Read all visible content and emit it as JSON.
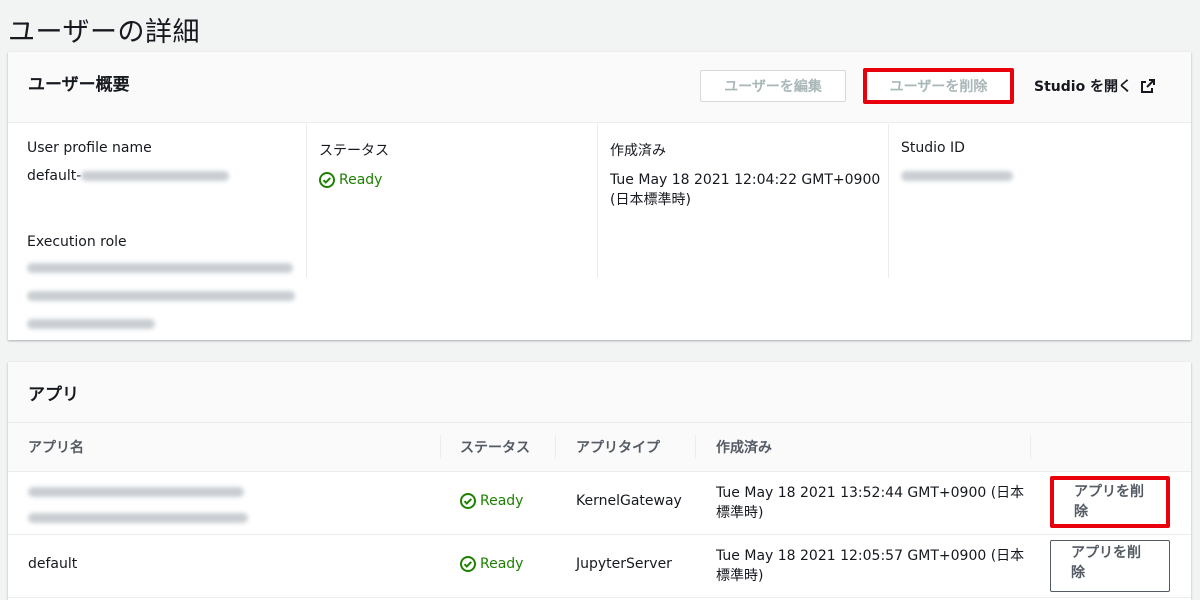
{
  "page": {
    "title": "ユーザーの詳細"
  },
  "summary": {
    "heading": "ユーザー概要",
    "edit_button": "ユーザーを編集",
    "delete_button": "ユーザーを削除",
    "studio_link": "Studio を開く",
    "fields": {
      "profile_name_label": "User profile name",
      "profile_name_value": "default-",
      "status_label": "ステータス",
      "status_value": "Ready",
      "created_label": "作成済み",
      "created_value_line1": "Tue May 18 2021 12:04:22 GMT+0900",
      "created_value_line2": "(日本標準時)",
      "studio_id_label": "Studio ID",
      "execution_role_label": "Execution role"
    }
  },
  "apps": {
    "heading": "アプリ",
    "columns": [
      "アプリ名",
      "ステータス",
      "アプリタイプ",
      "作成済み"
    ],
    "rows": [
      {
        "name": "",
        "status": "Ready",
        "type": "KernelGateway",
        "created_line1": "Tue May 18 2021 13:52:44 GMT+0900 (日本",
        "created_line2": "標準時)",
        "action_line1": "アプリを削",
        "action_line2": "除"
      },
      {
        "name": "default",
        "status": "Ready",
        "type": "JupyterServer",
        "created_line1": "Tue May 18 2021 12:05:57 GMT+0900 (日本",
        "created_line2": "標準時)",
        "action_line1": "アプリを削",
        "action_line2": "除"
      }
    ]
  },
  "colors": {
    "success": "#1d8102",
    "highlight": "#e8000b",
    "disabled_text": "#aab7b8"
  }
}
